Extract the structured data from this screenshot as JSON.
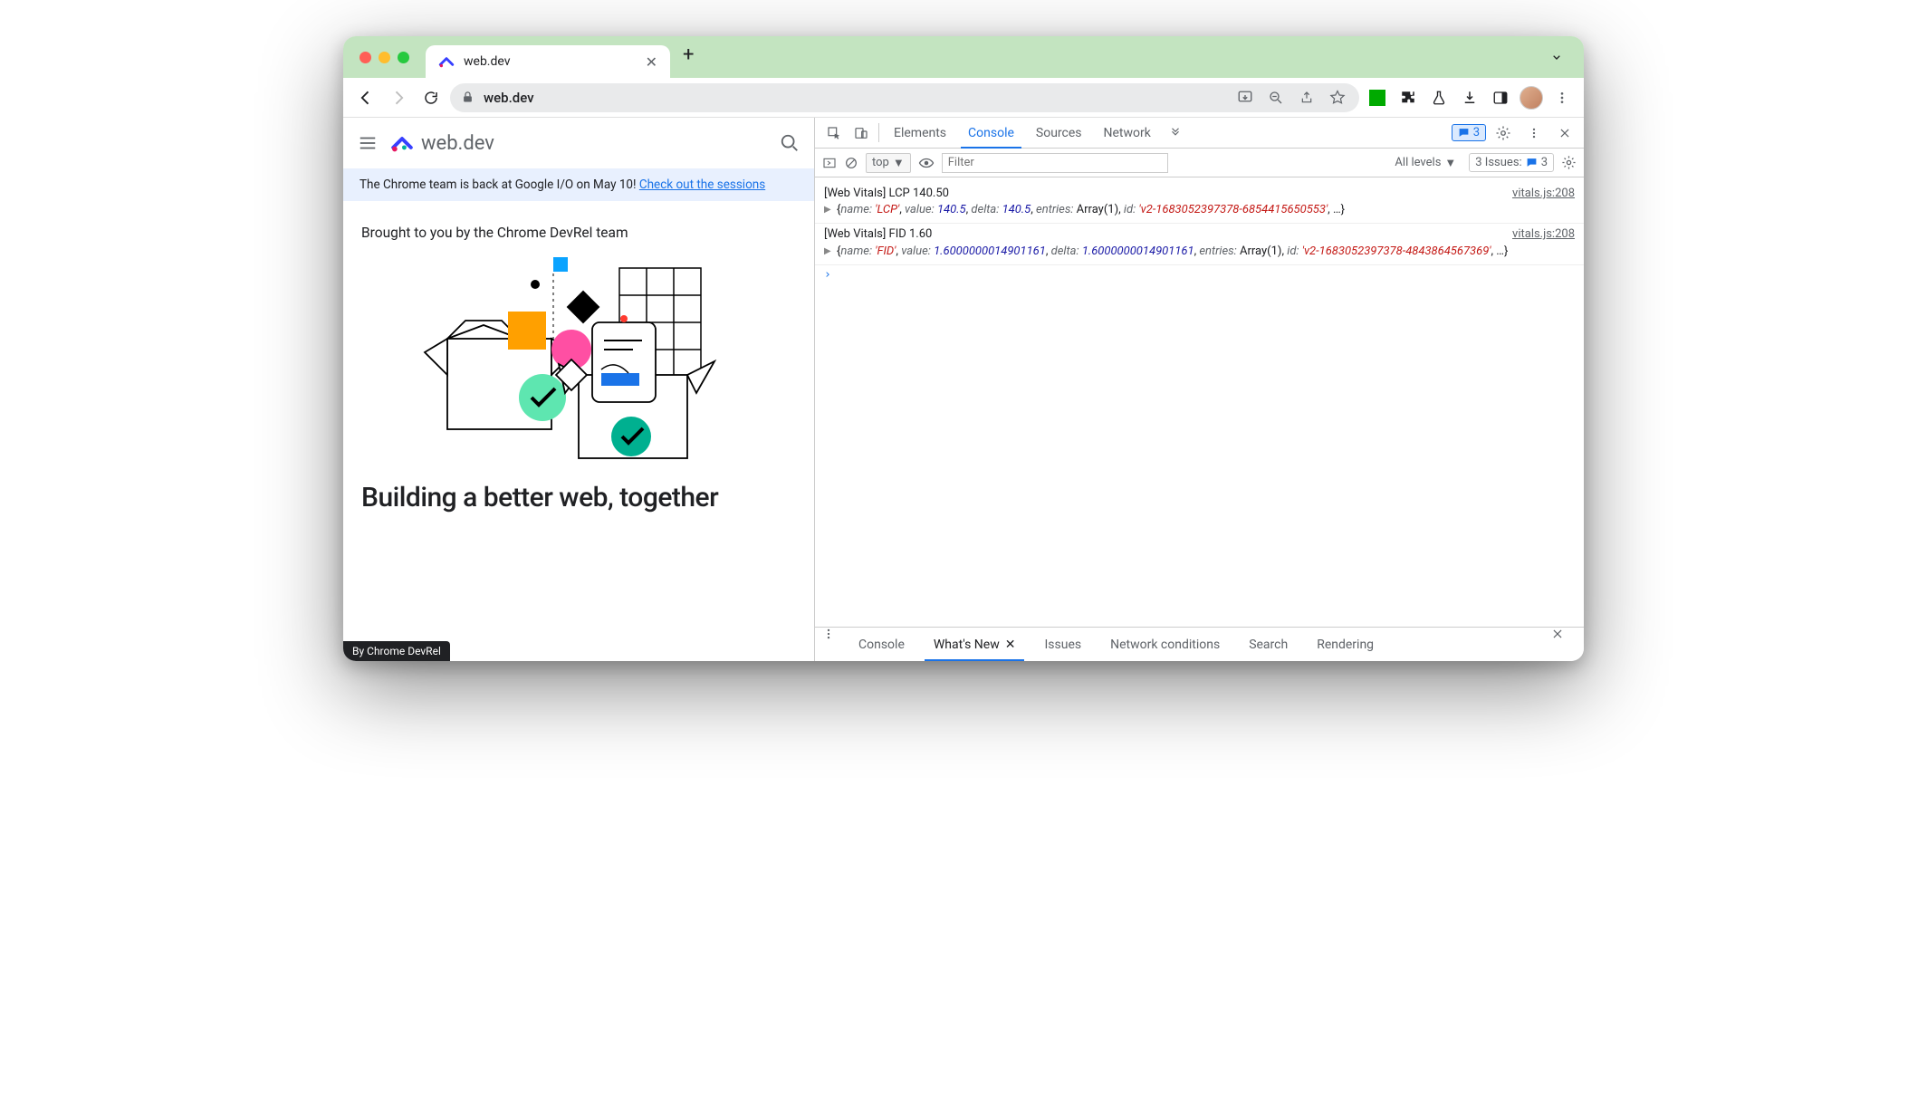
{
  "browser": {
    "tab_title": "web.dev",
    "url": "web.dev"
  },
  "page": {
    "site_name": "web.dev",
    "banner_text": "The Chrome team is back at Google I/O on May 10! ",
    "banner_link": "Check out the sessions",
    "hero_subtitle": "Brought to you by the Chrome DevRel team",
    "hero_title": "Building a better web, together",
    "byline": "By   Chrome DevRel"
  },
  "devtools": {
    "tabs": {
      "elements": "Elements",
      "console": "Console",
      "sources": "Sources",
      "network": "Network"
    },
    "messages_badge": "3",
    "context": "top",
    "filter_placeholder": "Filter",
    "levels": "All levels",
    "issues_label": "3 Issues:",
    "issues_count": "3",
    "log": [
      {
        "text": "[Web Vitals] LCP 140.50",
        "source": "vitals.js:208",
        "obj": {
          "name": "'LCP'",
          "value": "140.5",
          "delta": "140.5",
          "entries": "Array(1)",
          "id": "'v2-1683052397378-6854415650553'"
        }
      },
      {
        "text": "[Web Vitals] FID 1.60",
        "source": "vitals.js:208",
        "obj": {
          "name": "'FID'",
          "value": "1.6000000014901161",
          "delta": "1.6000000014901161",
          "entries": "Array(1)",
          "id": "'v2-1683052397378-4843864567369'"
        }
      }
    ],
    "drawer": {
      "console": "Console",
      "whatsnew": "What's New",
      "issues": "Issues",
      "netcond": "Network conditions",
      "search": "Search",
      "rendering": "Rendering"
    }
  }
}
